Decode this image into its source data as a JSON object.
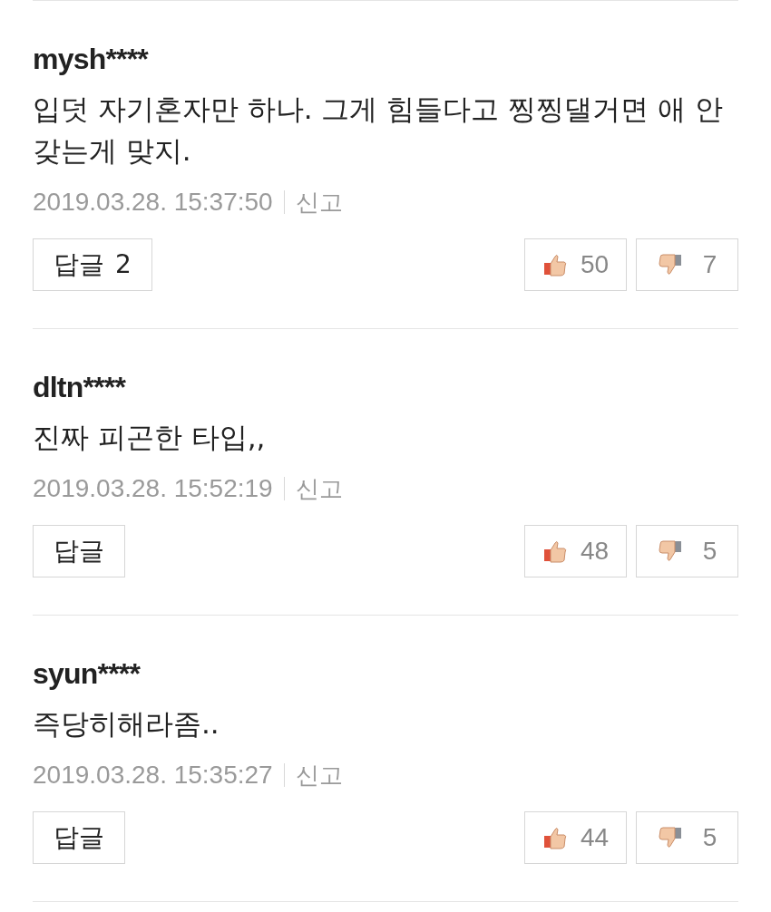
{
  "comments": [
    {
      "user": "mysh****",
      "text": "입덧 자기혼자만 하나. 그게 힘들다고 찡찡댈거면 애 안갖는게 맞지.",
      "date": "2019.03.28. 15:37:50",
      "report": "신고",
      "reply": "답글",
      "reply_count": "2",
      "likes": "50",
      "dislikes": "7"
    },
    {
      "user": "dltn****",
      "text": "진짜 피곤한 타입,,",
      "date": "2019.03.28. 15:52:19",
      "report": "신고",
      "reply": "답글",
      "likes": "48",
      "dislikes": "5"
    },
    {
      "user": "syun****",
      "text": "즉당히해라좀..",
      "date": "2019.03.28. 15:35:27",
      "report": "신고",
      "reply": "답글",
      "likes": "44",
      "dislikes": "5"
    }
  ]
}
